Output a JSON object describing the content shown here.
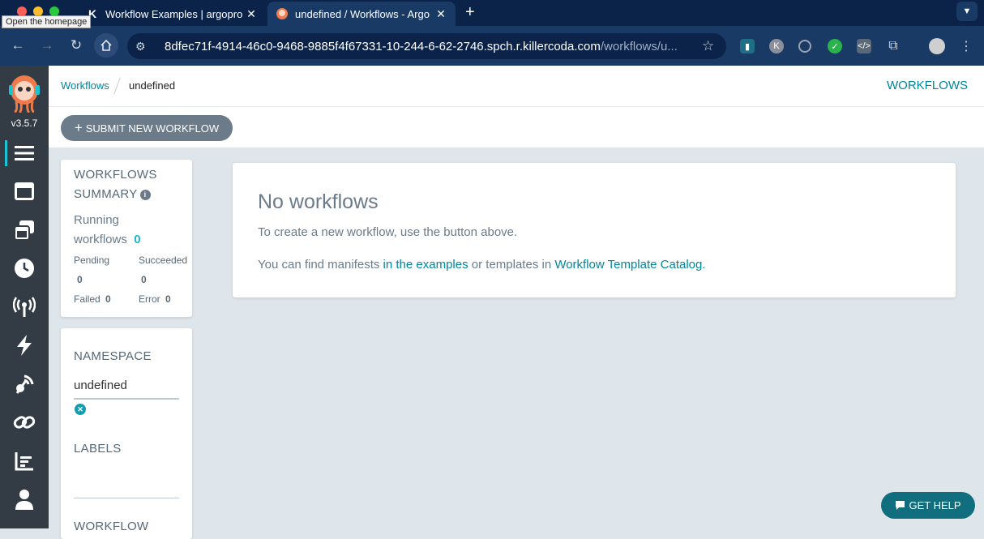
{
  "browser": {
    "tooltip": "Open the homepage",
    "tabs": [
      {
        "title": "Workflow Examples | argopro",
        "favicon": "K"
      },
      {
        "title": "undefined / Workflows - Argo"
      }
    ],
    "url_host": "8dfec71f-4914-46c0-9468-9885f4f67331-10-244-6-62-2746.spch.r.killercoda.com",
    "url_path": "/workflows/u..."
  },
  "sidebar": {
    "version": "v3.5.7",
    "items": [
      {
        "icon": "workflows-icon"
      },
      {
        "icon": "workflow-templates-icon"
      },
      {
        "icon": "cluster-workflow-templates-icon"
      },
      {
        "icon": "cron-workflows-icon"
      },
      {
        "icon": "event-sources-icon"
      },
      {
        "icon": "sensors-icon"
      },
      {
        "icon": "event-flow-icon"
      },
      {
        "icon": "links-icon"
      },
      {
        "icon": "reports-icon"
      },
      {
        "icon": "user-icon"
      }
    ]
  },
  "header": {
    "breadcrumb_link": "Workflows",
    "breadcrumb_current": "undefined",
    "section": "WORKFLOWS"
  },
  "actions": {
    "submit_label": "SUBMIT NEW WORKFLOW"
  },
  "summary": {
    "title_line1": "WORKFLOWS",
    "title_line2": "SUMMARY",
    "running_line1": "Running",
    "running_line2": "workflows",
    "running_count": "0",
    "pending_label": "Pending",
    "pending_count": "0",
    "succeeded_label": "Succeeded",
    "succeeded_count": "0",
    "failed_label": "Failed",
    "failed_count": "0",
    "error_label": "Error",
    "error_count": "0"
  },
  "filters": {
    "namespace_label": "NAMESPACE",
    "namespace_value": "undefined",
    "labels_label": "LABELS",
    "workflow_label": "WORKFLOW"
  },
  "empty_state": {
    "heading": "No workflows",
    "line1": "To create a new workflow, use the button above.",
    "line2_prefix": "You can find manifests ",
    "line2_link1": "in the examples",
    "line2_mid": " or templates in ",
    "line2_link2": "Workflow Template Catalog",
    "line2_suffix": "."
  },
  "help_label": "GET HELP",
  "colors": {
    "accent": "#00869b",
    "sidebar_bg": "#333c44",
    "browser_bg": "#0b2349"
  }
}
